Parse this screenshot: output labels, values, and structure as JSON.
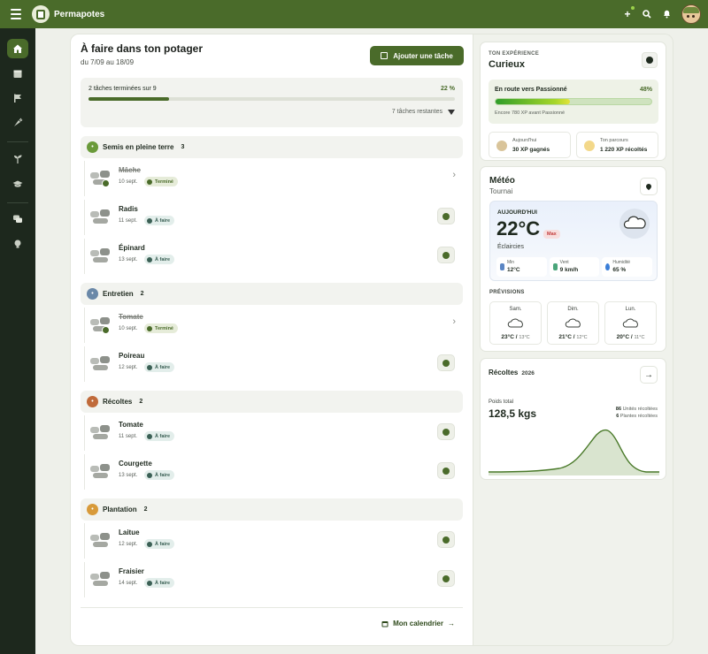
{
  "app": {
    "name": "Permapotes"
  },
  "colors": {
    "brand": "#4a6b2a",
    "sidebar": "#1d281d",
    "todo": "#3b6055",
    "max": "#c23b3b"
  },
  "header": {
    "icons": [
      "menu-icon",
      "plus-icon",
      "search-icon",
      "bell-icon",
      "avatar"
    ]
  },
  "sidebar": {
    "items": [
      "home-icon",
      "calendar-icon",
      "flag-icon",
      "carrot-icon",
      "sprout-icon",
      "graduation-cap-icon",
      "chat-icon",
      "lightbulb-icon"
    ]
  },
  "main": {
    "title": "À faire dans ton potager",
    "subtitle": "du 7/09 au 18/09",
    "add_button": "Ajouter une tâche",
    "progress": {
      "text": "2 tâches terminées sur 9",
      "percent_label": "22 %",
      "value": 0.22,
      "remaining": "7 tâches restantes"
    },
    "groups": [
      {
        "name": "Semis en pleine terre",
        "count": "3",
        "color": "#6a9a3a",
        "tasks": [
          {
            "name": "Mâche",
            "date": "10 sept.",
            "status": "Terminé",
            "done": true
          },
          {
            "name": "Radis",
            "date": "11 sept.",
            "status": "À faire",
            "done": false
          },
          {
            "name": "Épinard",
            "date": "13 sept.",
            "status": "À faire",
            "done": false
          }
        ]
      },
      {
        "name": "Entretien",
        "count": "2",
        "color": "#6a88a8",
        "tasks": [
          {
            "name": "Tomate",
            "date": "10 sept.",
            "status": "Terminé",
            "done": true
          },
          {
            "name": "Poireau",
            "date": "12 sept.",
            "status": "À faire",
            "done": false
          }
        ]
      },
      {
        "name": "Récoltes",
        "count": "2",
        "color": "#c06a3a",
        "tasks": [
          {
            "name": "Tomate",
            "date": "11 sept.",
            "status": "À faire",
            "done": false
          },
          {
            "name": "Courgette",
            "date": "13 sept.",
            "status": "À faire",
            "done": false
          }
        ]
      },
      {
        "name": "Plantation",
        "count": "2",
        "color": "#d89a3a",
        "tasks": [
          {
            "name": "Laitue",
            "date": "12 sept.",
            "status": "À faire",
            "done": false
          },
          {
            "name": "Fraisier",
            "date": "14 sept.",
            "status": "À faire",
            "done": false
          }
        ]
      }
    ],
    "calendar_link": "Mon calendrier"
  },
  "experience": {
    "label": "TON EXPÉRIENCE",
    "level": "Curieux",
    "next_label": "En route vers Passionné",
    "percent_label": "48%",
    "value": 0.48,
    "remaining": "Encore 780 XP avant Passionné",
    "today_label": "Aujourd'hui",
    "today_value": "30 XP gagnés",
    "journey_label": "Ton parcours",
    "journey_value": "1 220 XP récoltés"
  },
  "weather": {
    "title": "Météo",
    "city": "Tournai",
    "today_label": "AUJOURD'HUI",
    "temp": "22°C",
    "max_label": "Max",
    "condition": "Éclaircies",
    "min_label": "Min",
    "min_value": "12°C",
    "wind_label": "Vent",
    "wind_value": "9 km/h",
    "humidity_label": "Humidité",
    "humidity_value": "65 %",
    "forecast_label": "PRÉVISIONS",
    "forecast": [
      {
        "day": "Sam.",
        "high": "23°C",
        "low": "13°C"
      },
      {
        "day": "Dim.",
        "high": "21°C",
        "low": "12°C"
      },
      {
        "day": "Lun.",
        "high": "20°C",
        "low": "11°C"
      }
    ]
  },
  "harvest": {
    "title": "Récoltes",
    "year": "2026",
    "weight_label": "Poids total",
    "weight": "128,5 kgs",
    "units_count": "86",
    "units_label": "Unités récoltées",
    "plants_count": "6",
    "plants_label": "Plantes récoltées"
  }
}
